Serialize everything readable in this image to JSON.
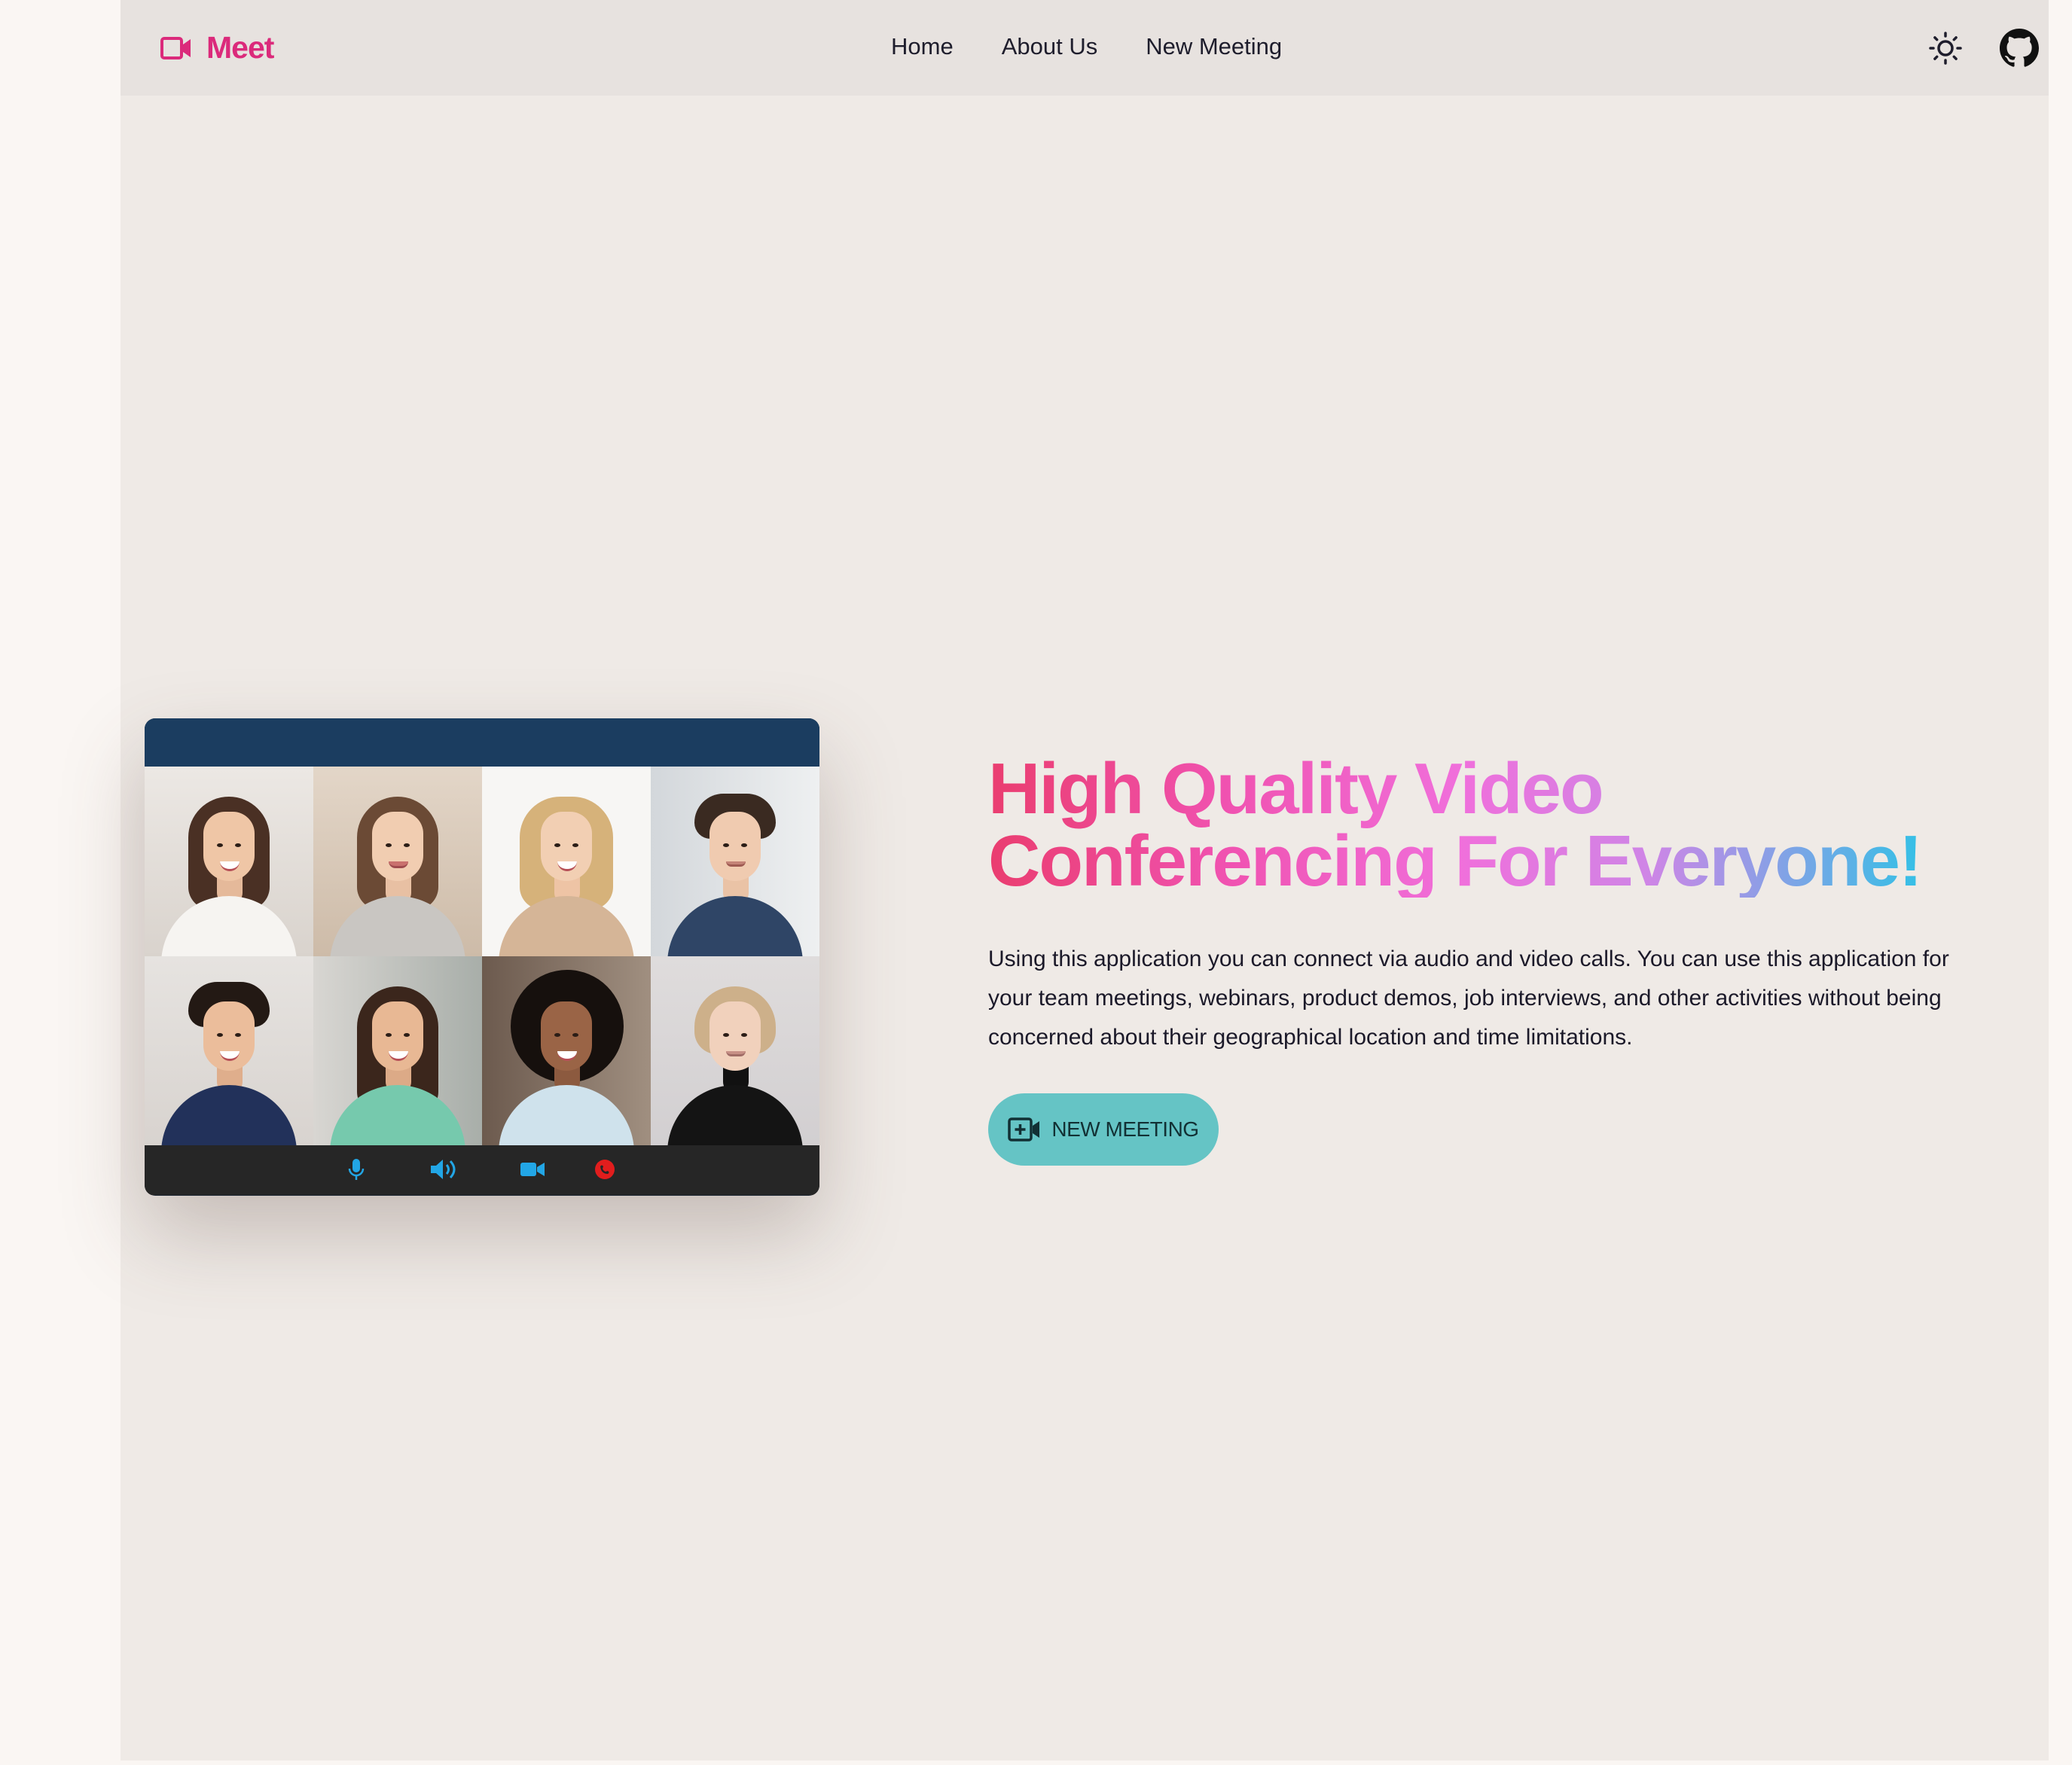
{
  "brand": {
    "name": "Meet",
    "icon": "video-camera-icon",
    "color": "#db2a7b"
  },
  "nav": {
    "links": [
      "Home",
      "About Us",
      "New Meeting"
    ]
  },
  "header_icons": {
    "theme_toggle": "sun-icon",
    "repo": "github-icon"
  },
  "hero": {
    "title_line1": "High Quality Video",
    "title_line2": "Conferencing For Everyone!",
    "description": "Using this application you can connect via audio and video calls. You can use this application for your team meetings, webinars, product demos, job interviews, and other activities without being concerned about their geographical location and time limitations.",
    "cta_label": "NEW MEETING",
    "cta_icon": "video-plus-icon",
    "gradient_colors": [
      "#ea3d6f",
      "#f052b0",
      "#f06fdb",
      "#cf85e6",
      "#2fc2e6"
    ],
    "cta_color": "#65c4c5"
  },
  "video_window": {
    "participants": 8,
    "controls": [
      "microphone-icon",
      "speaker-icon",
      "camera-icon",
      "end-call-icon"
    ],
    "control_colors": {
      "default": "#22a6e6",
      "end_call": "#e11d1d"
    },
    "titlebar_color": "#1b3d60"
  }
}
